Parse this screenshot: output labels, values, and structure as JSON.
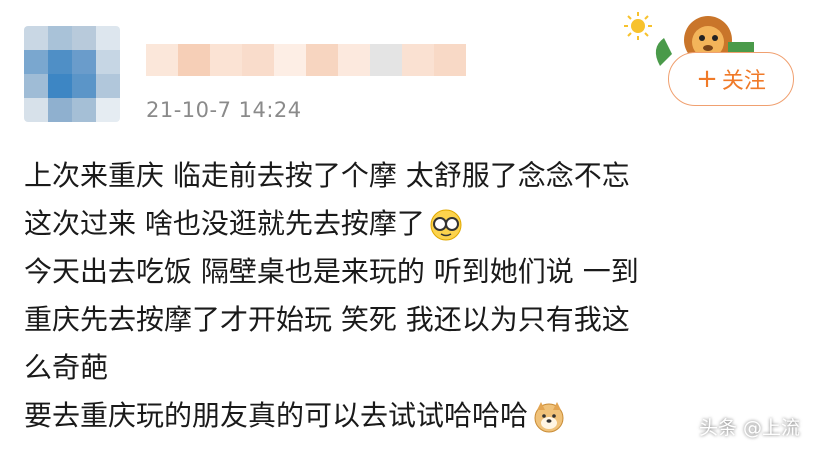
{
  "post": {
    "timestamp": "21-10-7 14:24",
    "follow_label": "关注",
    "lines": [
      "上次来重庆 临走前去按了个摩 太舒服了念念不忘",
      "这次过来 啥也没逛就先去按摩了",
      "今天出去吃饭 隔壁桌也是来玩的 听到她们说 一到",
      "重庆先去按摩了才开始玩 笑死 我还以为只有我这",
      "么奇葩",
      "要去重庆玩的朋友真的可以去试试哈哈哈"
    ]
  },
  "watermark": "头条 @上流",
  "colors": {
    "accent": "#f07a28",
    "timestamp": "#8a8a8a"
  },
  "icons": [
    "lion-sticker-icon",
    "glasses-emoji-icon",
    "doge-emoji-icon",
    "plus-icon"
  ]
}
